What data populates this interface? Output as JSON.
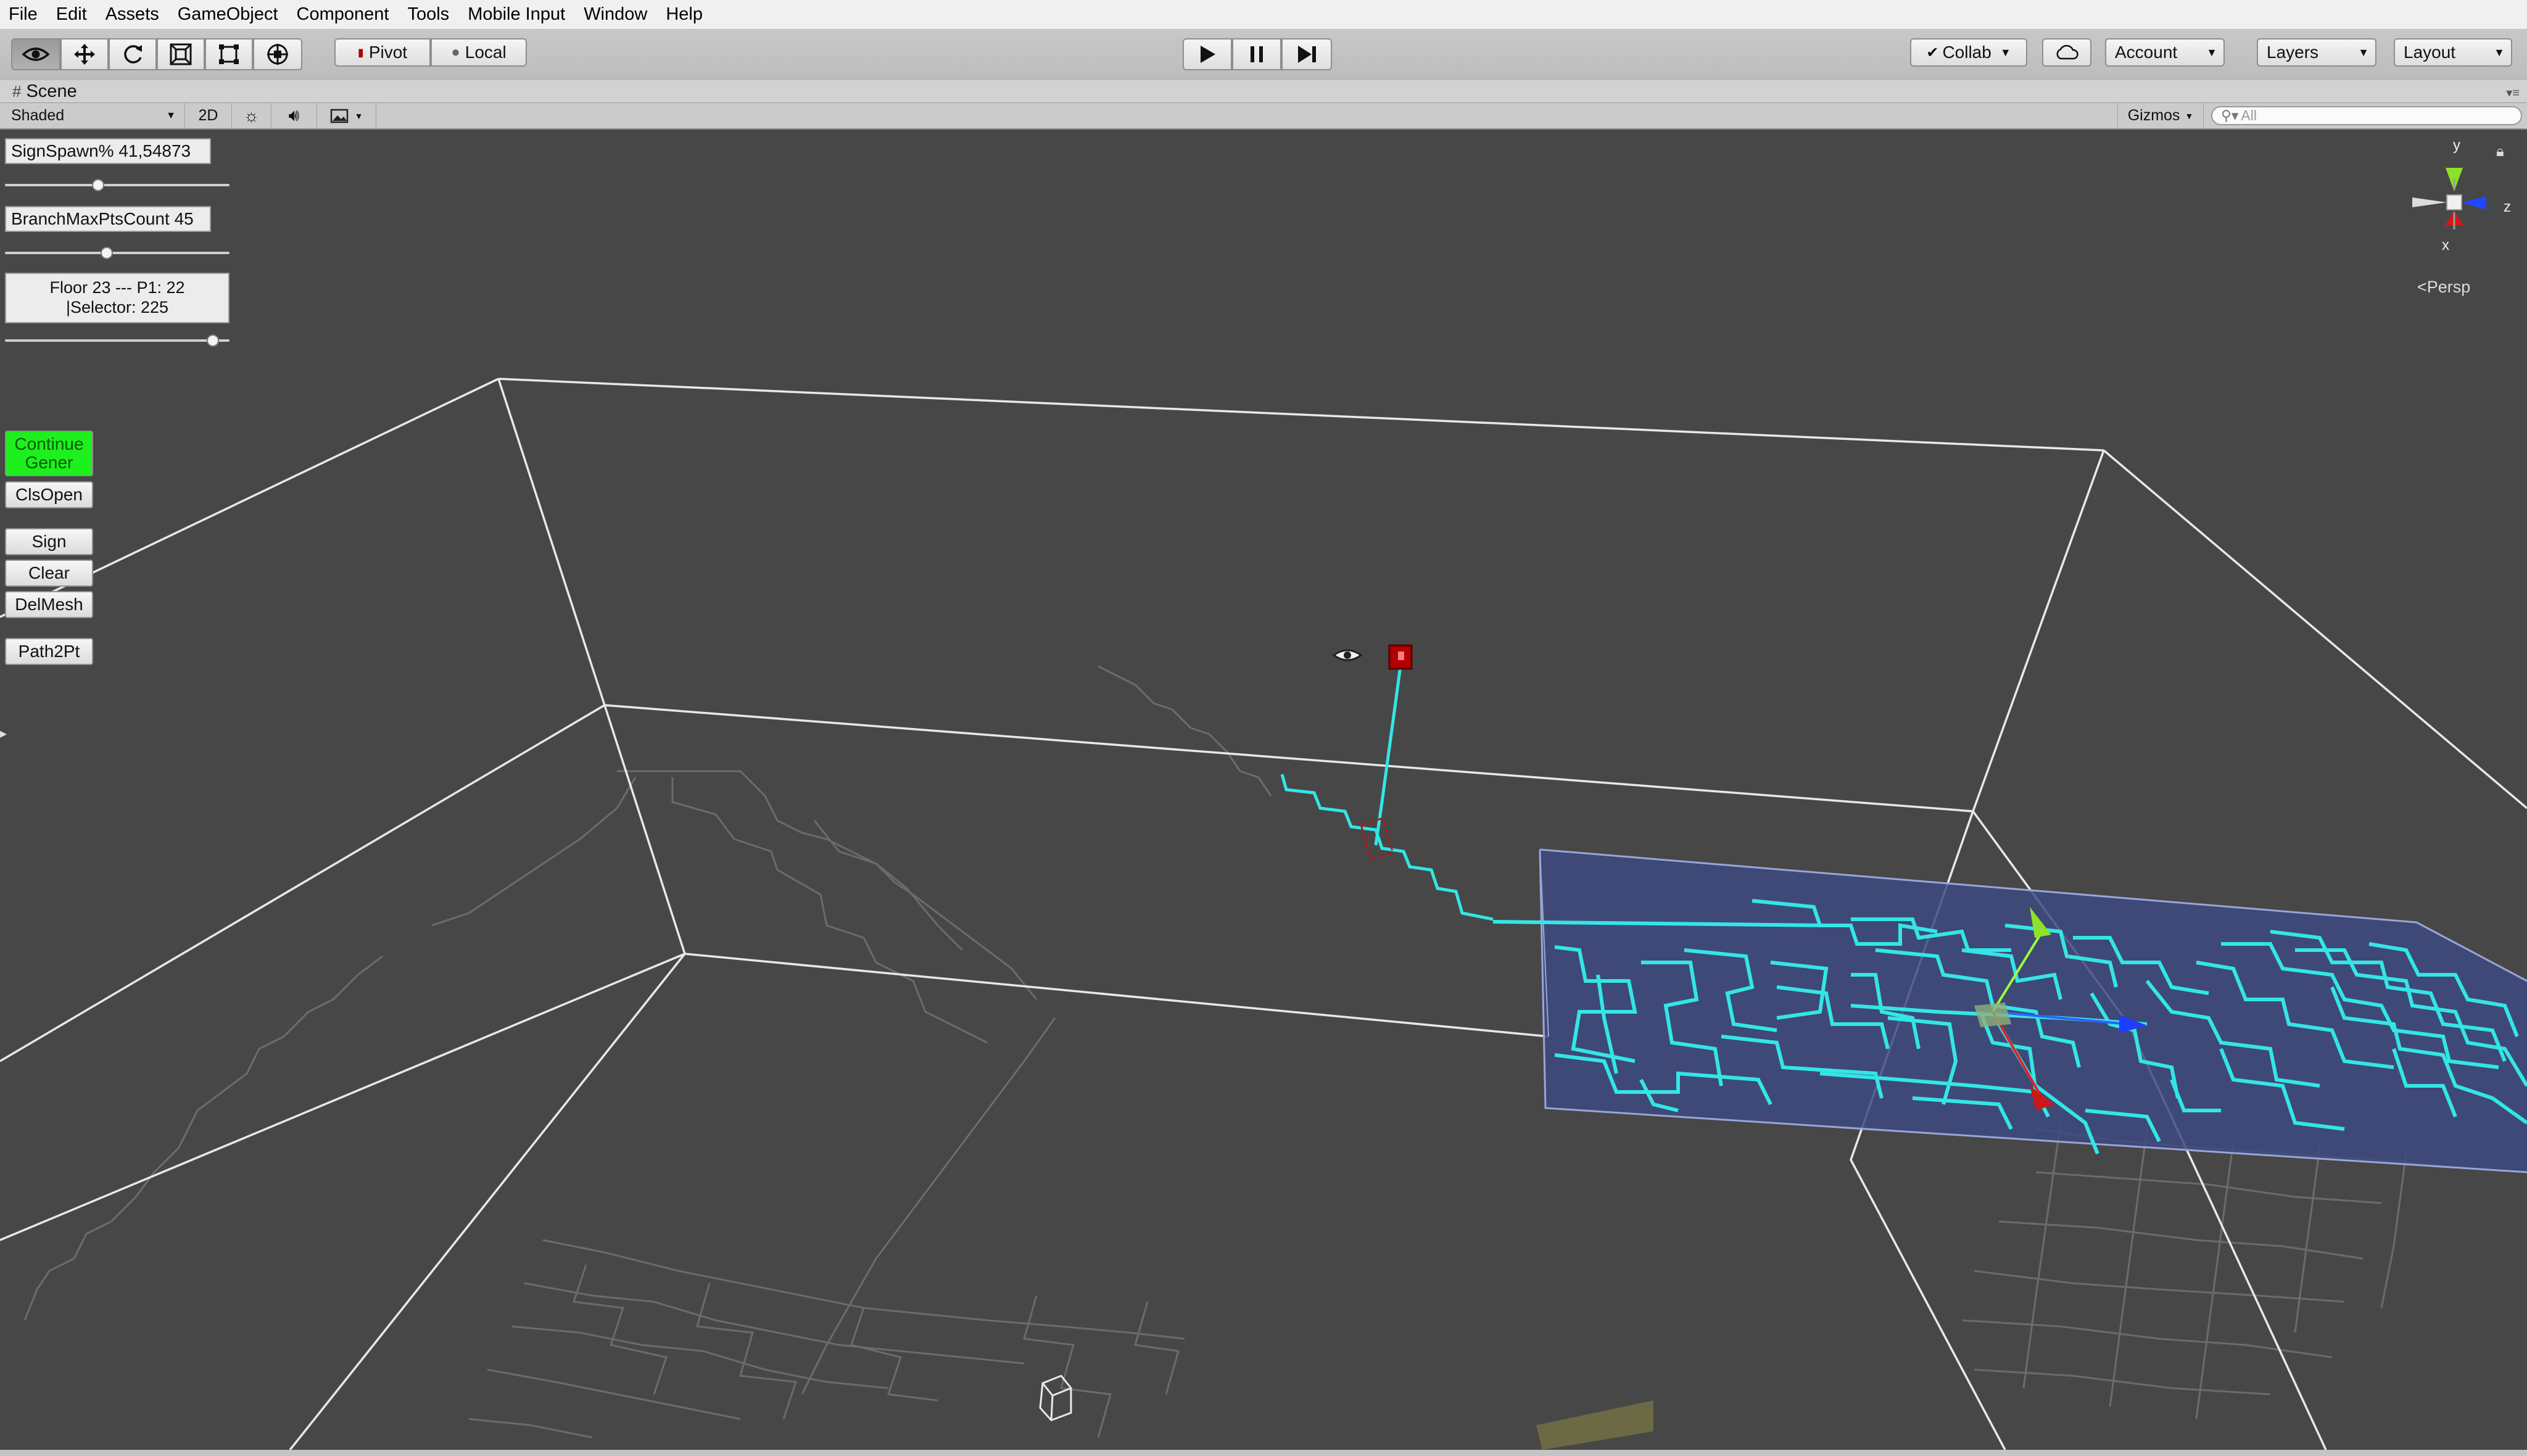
{
  "menu": [
    "File",
    "Edit",
    "Assets",
    "GameObject",
    "Component",
    "Tools",
    "Mobile Input",
    "Window",
    "Help"
  ],
  "toolbar": {
    "pivot_label": "Pivot",
    "local_label": "Local",
    "collab_label": "Collab",
    "account_label": "Account",
    "layers_label": "Layers",
    "layout_label": "Layout"
  },
  "scene": {
    "tab_label": "Scene",
    "shading_mode": "Shaded",
    "mode_2d": "2D",
    "gizmos_label": "Gizmos",
    "search_placeholder": "All",
    "projection_label": "Persp",
    "axis_y": "y",
    "axis_z": "z",
    "axis_x": "x"
  },
  "overlay": {
    "sign_spawn_label": "SignSpawn% 41,54873",
    "sign_spawn_slider": 0.41,
    "branch_label": "BranchMaxPtsCount 45",
    "branch_slider": 0.45,
    "info_line1": "Floor 23 --- P1: 22",
    "info_line2": "|Selector: 225",
    "info_slider": 0.95,
    "buttons": {
      "continue_line1": "Continue",
      "continue_line2": "Gener",
      "clsopen": "ClsOpen",
      "sign": "Sign",
      "clear": "Clear",
      "delmesh": "DelMesh",
      "path2pt": "Path2Pt"
    }
  },
  "colors": {
    "maze_path": "#33e6e6",
    "maze_floor": "#3d4a80",
    "continue_button": "#1ef01e",
    "spawn_marker": "#b00000"
  }
}
